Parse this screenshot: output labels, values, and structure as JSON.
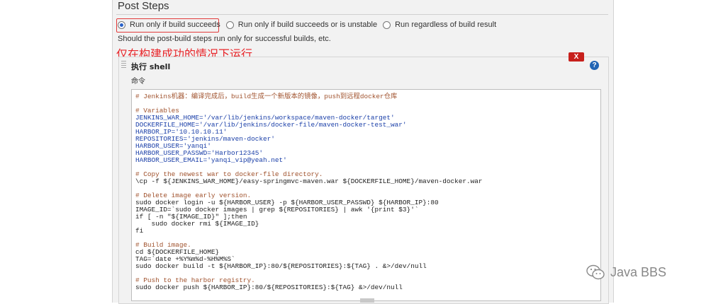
{
  "section": {
    "title": "Post Steps"
  },
  "radios": [
    {
      "label": "Run only if build succeeds",
      "selected": true
    },
    {
      "label": "Run only if build succeeds or is unstable",
      "selected": false
    },
    {
      "label": "Run regardless of build result",
      "selected": false
    }
  ],
  "help_text": "Should the post-build steps run only for successful builds, etc.",
  "annotation": "仅在构建成功的情况下运行",
  "step": {
    "delete_label": "X",
    "title": "执行 shell",
    "help_label": "?",
    "field_label": "命令"
  },
  "code_lines": [
    {
      "text": "# Jenkins机器：编译完成后，build生成一个新版本的镜像，push到远程docker仓库",
      "color": "#a0522d"
    },
    {
      "text": "",
      "color": "#333333"
    },
    {
      "text": "# Variables",
      "color": "#a0522d"
    },
    {
      "text": "JENKINS_WAR_HOME='/var/lib/jenkins/workspace/maven-docker/target'",
      "color": "#1a3fa8"
    },
    {
      "text": "DOCKERFILE_HOME='/var/lib/jenkins/docker-file/maven-docker-test_war'",
      "color": "#1a3fa8"
    },
    {
      "text": "HARBOR_IP='10.10.10.11'",
      "color": "#1a3fa8"
    },
    {
      "text": "REPOSITORIES='jenkins/maven-docker'",
      "color": "#1a3fa8"
    },
    {
      "text": "HARBOR_USER='yanqi'",
      "color": "#1a3fa8"
    },
    {
      "text": "HARBOR_USER_PASSWD='Harbor12345'",
      "color": "#1a3fa8"
    },
    {
      "text": "HARBOR_USER_EMAIL='yanqi_vip@yeah.net'",
      "color": "#1a3fa8"
    },
    {
      "text": "",
      "color": "#333333"
    },
    {
      "text": "# Copy the newest war to docker-file directory.",
      "color": "#a0522d"
    },
    {
      "text": "\\cp -f ${JENKINS_WAR_HOME}/easy-springmvc-maven.war ${DOCKERFILE_HOME}/maven-docker.war",
      "color": "#222222"
    },
    {
      "text": "",
      "color": "#333333"
    },
    {
      "text": "# Delete image early version.",
      "color": "#a0522d"
    },
    {
      "text": "sudo docker login -u ${HARBOR_USER} -p ${HARBOR_USER_PASSWD} ${HARBOR_IP}:80",
      "color": "#222222"
    },
    {
      "text": "IMAGE_ID=`sudo docker images | grep ${REPOSITORIES} | awk '{print $3}'`",
      "color": "#222222"
    },
    {
      "text": "if [ -n \"${IMAGE_ID}\" ];then",
      "color": "#222222"
    },
    {
      "text": "    sudo docker rmi ${IMAGE_ID}",
      "color": "#222222"
    },
    {
      "text": "fi",
      "color": "#222222"
    },
    {
      "text": "",
      "color": "#333333"
    },
    {
      "text": "# Build image.",
      "color": "#a0522d"
    },
    {
      "text": "cd ${DOCKERFILE_HOME}",
      "color": "#222222"
    },
    {
      "text": "TAG=`date +%Y%m%d-%H%M%S`",
      "color": "#222222"
    },
    {
      "text": "sudo docker build -t ${HARBOR_IP}:80/${REPOSITORIES}:${TAG} . &>/dev/null",
      "color": "#222222"
    },
    {
      "text": "",
      "color": "#333333"
    },
    {
      "text": "# Push to the harbor registry.",
      "color": "#a0522d"
    },
    {
      "text": "sudo docker push ${HARBOR_IP}:80/${REPOSITORIES}:${TAG} &>/dev/null",
      "color": "#222222"
    }
  ],
  "watermark": {
    "text": "Java BBS",
    "icon": "wechat-icon"
  }
}
